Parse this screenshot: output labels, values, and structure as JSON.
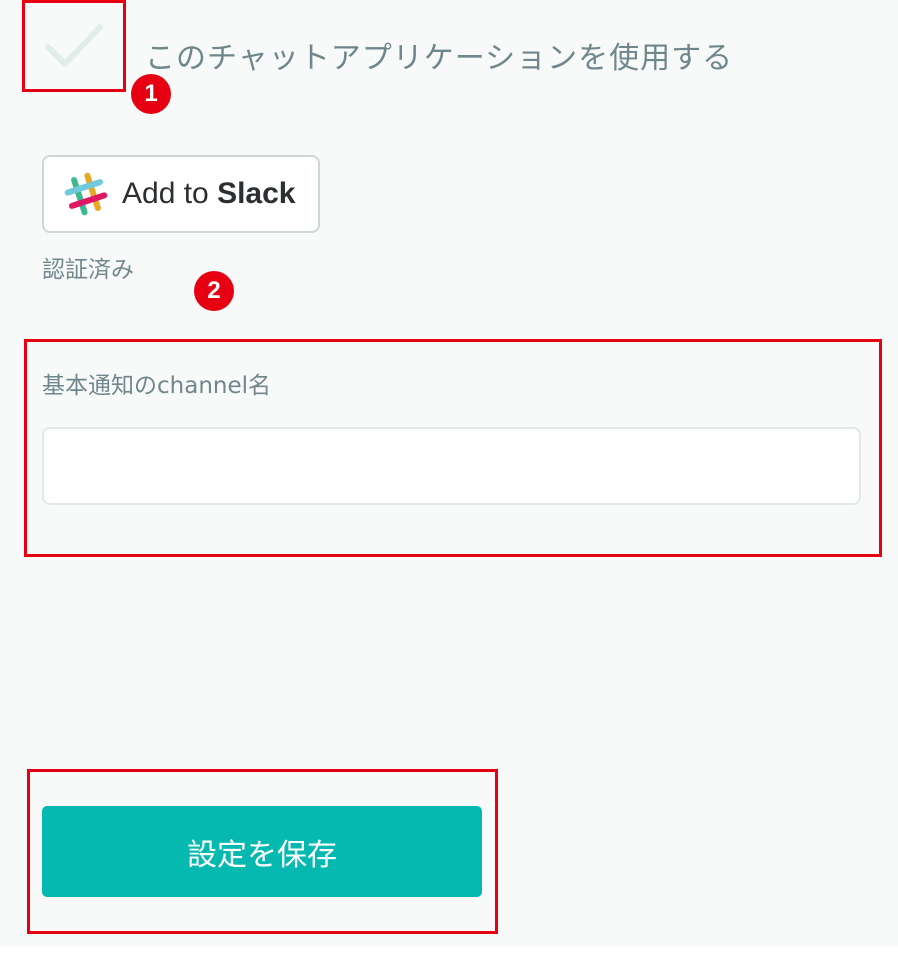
{
  "settings": {
    "use_app_label": "このチャットアプリケーションを使用する",
    "use_app_checked": true,
    "slack_button": {
      "prefix": "Add to ",
      "brand": "Slack"
    },
    "auth_status": "認証済み",
    "channel_field": {
      "label": "基本通知のchannel名",
      "value": "",
      "placeholder": ""
    },
    "save_label": "設定を保存"
  },
  "annotations": {
    "badges": [
      "1",
      "2"
    ]
  },
  "colors": {
    "accent": "#05b9b1",
    "annotation_red": "#e60012",
    "text_muted": "#6f878c",
    "background": "#f8faf9",
    "checkmark": "#dfeeea"
  },
  "icons": {
    "checkbox": "checkmark-icon",
    "slack": "slack-logo-icon"
  }
}
